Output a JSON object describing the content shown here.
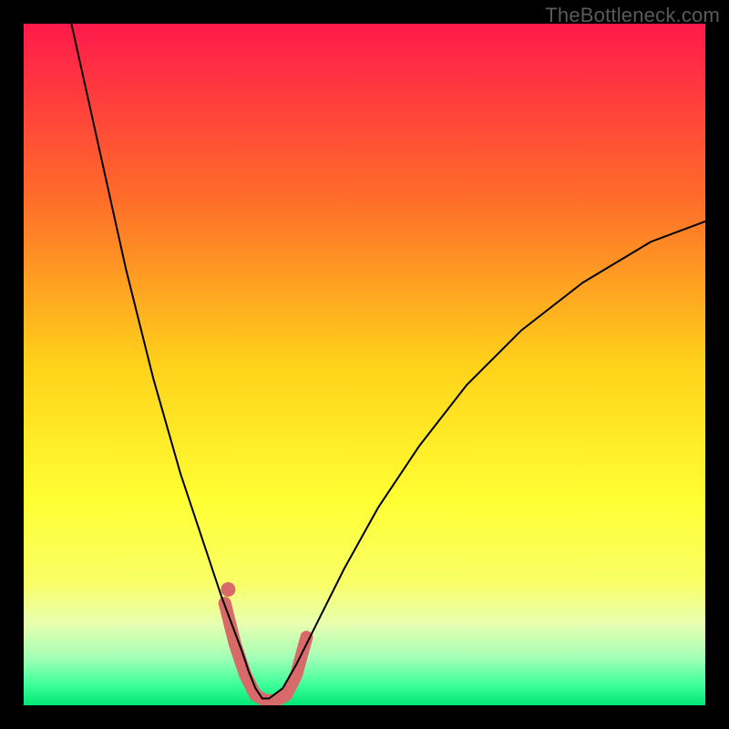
{
  "watermark": "TheBottleneck.com",
  "chart_data": {
    "type": "line",
    "title": "",
    "xlabel": "",
    "ylabel": "",
    "xlim": [
      0,
      100
    ],
    "ylim": [
      0,
      100
    ],
    "grid": false,
    "legend": false,
    "background_gradient": {
      "stops": [
        {
          "offset": 0.0,
          "color": "#ff1a4b"
        },
        {
          "offset": 0.25,
          "color": "#ff6a2a"
        },
        {
          "offset": 0.5,
          "color": "#ffd21a"
        },
        {
          "offset": 0.7,
          "color": "#ffff33"
        },
        {
          "offset": 0.82,
          "color": "#f9ff66"
        },
        {
          "offset": 0.88,
          "color": "#e8ffb0"
        },
        {
          "offset": 0.93,
          "color": "#a3ffb6"
        },
        {
          "offset": 0.97,
          "color": "#3dff99"
        },
        {
          "offset": 1.0,
          "color": "#00e676"
        }
      ]
    },
    "series": [
      {
        "name": "curve",
        "color": "#000000",
        "width": 2,
        "x": [
          7,
          9,
          11,
          13,
          15,
          17,
          19,
          21,
          23,
          25,
          27,
          29,
          30.5,
          32,
          33,
          34,
          35,
          36,
          38,
          40,
          43,
          47,
          52,
          58,
          65,
          73,
          82,
          92,
          100
        ],
        "y": [
          100,
          91,
          82,
          73,
          64,
          56,
          48,
          41,
          34,
          28,
          22,
          16,
          12,
          8,
          5,
          2.5,
          1,
          1,
          2.5,
          6,
          12,
          20,
          29,
          38,
          47,
          55,
          62,
          68,
          71
        ]
      },
      {
        "name": "highlight-band",
        "color": "#d96a6a",
        "width": 14,
        "linecap": "round",
        "x": [
          29.5,
          31,
          32.5,
          34,
          35.5,
          37,
          38.5,
          40,
          41.5
        ],
        "y": [
          15,
          9,
          4.5,
          1.5,
          0.7,
          0.7,
          1.5,
          4.5,
          10
        ]
      },
      {
        "name": "highlight-dot",
        "type": "scatter",
        "color": "#d96a6a",
        "radius": 8,
        "x": [
          30
        ],
        "y": [
          17
        ]
      }
    ]
  }
}
